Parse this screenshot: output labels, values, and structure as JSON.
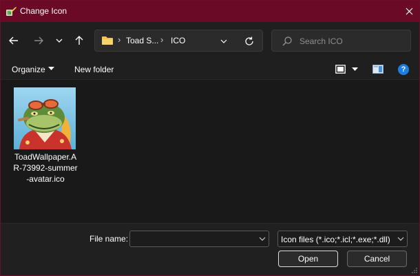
{
  "window": {
    "title": "Change Icon",
    "title_bar_color": "#6b0a26",
    "app_icon": "change-icon-app-icon",
    "close_icon": "close-icon"
  },
  "nav": {
    "back_icon": "arrow-left-icon",
    "forward_icon": "arrow-right-icon",
    "recent_icon": "chevron-down-icon",
    "up_icon": "arrow-up-icon",
    "breadcrumbs": [
      "Toad S...",
      "ICO"
    ],
    "refresh_icon": "refresh-icon",
    "search_placeholder": "Search ICO"
  },
  "toolbar": {
    "organize_label": "Organize",
    "new_folder_label": "New folder",
    "view_icon": "view-mode-icon",
    "preview_icon": "preview-pane-icon",
    "help_label": "?"
  },
  "files": [
    {
      "name": "ToadWallpaper.AR-73992-summer-avatar.ico",
      "display_lines": [
        "ToadWallpaper.A",
        "R-73992-summer",
        "-avatar.ico"
      ],
      "thumbnail": "toad-avatar-thumbnail"
    }
  ],
  "footer": {
    "file_name_label": "File name:",
    "file_name_value": "",
    "file_type_selected": "Icon files (*.ico;*.icl;*.exe;*.dll)",
    "open_label": "Open",
    "cancel_label": "Cancel"
  },
  "colors": {
    "accent": "#1a7fe0",
    "folder": "#f4c24d"
  }
}
